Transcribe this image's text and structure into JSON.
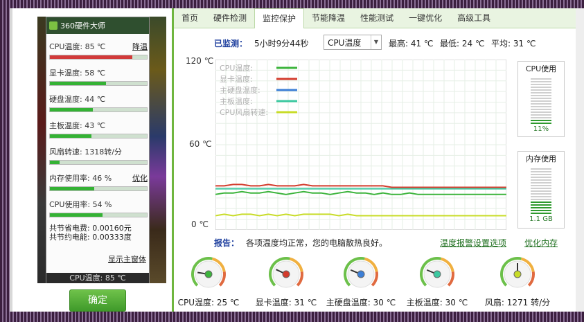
{
  "widget": {
    "title": "360硬件大师",
    "rows": [
      {
        "label": "CPU温度: 85 ℃",
        "link": "降温",
        "fill": 0.85,
        "color": "red"
      },
      {
        "label": "显卡温度: 58 ℃",
        "link": "",
        "fill": 0.58,
        "color": "green"
      },
      {
        "label": "硬盘温度: 44 ℃",
        "link": "",
        "fill": 0.44,
        "color": "green"
      },
      {
        "label": "主板温度: 43 ℃",
        "link": "",
        "fill": 0.43,
        "color": "green"
      },
      {
        "label": "风扇转速: 1318转/分",
        "link": "",
        "fill": 0.1,
        "color": "green"
      },
      {
        "label": "内存使用率: 46 %",
        "link": "优化",
        "fill": 0.46,
        "color": "green"
      },
      {
        "label": "CPU使用率: 54 %",
        "link": "",
        "fill": 0.54,
        "color": "green"
      }
    ],
    "save_fee": "共节省电费: 0.00160元",
    "save_energy": "共节约电能: 0.00333度",
    "show_main": "显示主窗体",
    "bottom_text": "CPU温度: 85 ℃"
  },
  "confirm_label": "确定",
  "tabs": [
    "首页",
    "硬件检测",
    "监控保护",
    "节能降温",
    "性能测试",
    "一键优化",
    "高级工具"
  ],
  "active_tab": 2,
  "status": {
    "monitored_label": "已监测：",
    "monitored_value": "5小时9分44秒",
    "select_value": "CPU温度",
    "max": "最高: 41 ℃",
    "min": "最低: 24 ℃",
    "avg": "平均: 31 ℃"
  },
  "chart_data": {
    "type": "line",
    "yticks": [
      "120 ℃",
      "60 ℃",
      "0 ℃"
    ],
    "ylim": [
      0,
      120
    ],
    "legend": [
      "CPU温度:",
      "显卡温度:",
      "主硬盘温度:",
      "主板温度:",
      "CPU风扇转速:"
    ],
    "legend_colors": [
      "#3cb43c",
      "#d33b2c",
      "#3c7fd6",
      "#3cc8a0",
      "#c8dc28"
    ],
    "series": [
      {
        "name": "CPU温度",
        "color": "#3cb43c",
        "values": [
          25,
          26,
          26,
          27,
          26,
          26,
          27,
          26,
          25,
          26,
          27,
          26,
          26,
          25,
          26,
          27,
          26,
          26,
          25,
          26,
          25,
          25,
          26,
          25,
          25,
          25,
          25,
          25,
          25,
          25,
          25,
          25,
          25,
          25
        ]
      },
      {
        "name": "显卡温度",
        "color": "#d33b2c",
        "values": [
          31,
          31,
          32,
          32,
          31,
          31,
          32,
          31,
          31,
          31,
          32,
          31,
          31,
          31,
          31,
          31,
          31,
          31,
          31,
          31,
          30,
          30,
          30,
          30,
          30,
          30,
          30,
          30,
          30,
          30,
          30,
          30,
          30,
          30
        ]
      },
      {
        "name": "主板温度",
        "color": "#3cc8a0",
        "values": [
          29,
          29,
          29,
          29,
          29,
          29,
          29,
          29,
          29,
          29,
          29,
          29,
          29,
          29,
          29,
          29,
          29,
          29,
          29,
          29,
          29,
          29,
          29,
          29,
          29,
          29,
          29,
          29,
          29,
          29,
          29,
          29,
          29,
          29
        ]
      },
      {
        "name": "CPU风扇转速",
        "color": "#c8dc28",
        "values": [
          10,
          11,
          10,
          11,
          11,
          10,
          11,
          10,
          11,
          10,
          11,
          11,
          11,
          11,
          10,
          11,
          10,
          10,
          10,
          10,
          10,
          10,
          10,
          10,
          10,
          10,
          10,
          10,
          10,
          10,
          10,
          10,
          10,
          10
        ]
      }
    ]
  },
  "cpu_usage": {
    "title": "CPU使用",
    "value": "11%",
    "fraction": 0.11
  },
  "mem_usage": {
    "title": "内存使用",
    "value": "1.1 GB",
    "fraction": 0.3
  },
  "report": {
    "label": "报告：",
    "text": "各项温度均正常，您的电脑散热良好。"
  },
  "links": {
    "alarm": "温度报警设置选项",
    "optimize": "优化内存"
  },
  "dials": [
    {
      "label": "CPU温度: 25 ℃",
      "color": "#3cb43c",
      "fraction": 0.2
    },
    {
      "label": "显卡温度: 31 ℃",
      "color": "#d33b2c",
      "fraction": 0.26
    },
    {
      "label": "主硬盘温度: 30 ℃",
      "color": "#3c7fd6",
      "fraction": 0.25
    },
    {
      "label": "主板温度: 30 ℃",
      "color": "#3cc8a0",
      "fraction": 0.25
    },
    {
      "label": "风扇: 1271 转/分",
      "color": "#c8dc28",
      "fraction": 0.5
    }
  ]
}
